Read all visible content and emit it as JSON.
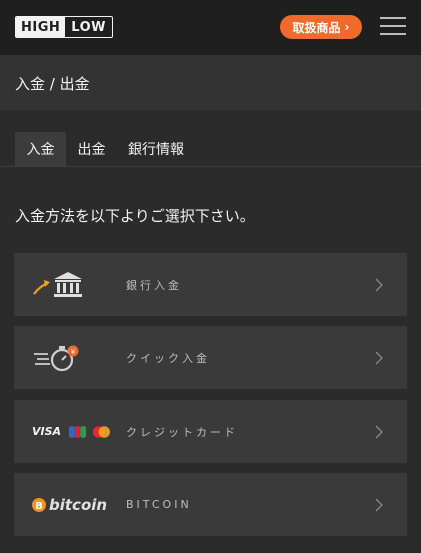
{
  "header": {
    "logo": {
      "high": "HIGH",
      "low": "LOW"
    },
    "products_button": "取扱商品",
    "menu_icon": "hamburger-icon"
  },
  "breadcrumb": "入金 / 出金",
  "tabs": [
    {
      "label": "入金",
      "active": true
    },
    {
      "label": "出金",
      "active": false
    },
    {
      "label": "銀行情報",
      "active": false
    }
  ],
  "instruction": "入金方法を以下よりご選択下さい。",
  "methods": [
    {
      "label": "銀行入金",
      "icon": "bank-icon"
    },
    {
      "label": "クイック入金",
      "icon": "quick-deposit-icon"
    },
    {
      "label": "クレジットカード",
      "icon": "credit-card-brands-icon",
      "visa": "VISA"
    },
    {
      "label": "BITCOIN",
      "icon": "bitcoin-icon",
      "brand": "bitcoin"
    }
  ],
  "colors": {
    "accent": "#f06b2b",
    "header_bg": "#1f1f1f",
    "row_bg": "#3a3a3a",
    "page_bg": "#2b2b2b"
  }
}
